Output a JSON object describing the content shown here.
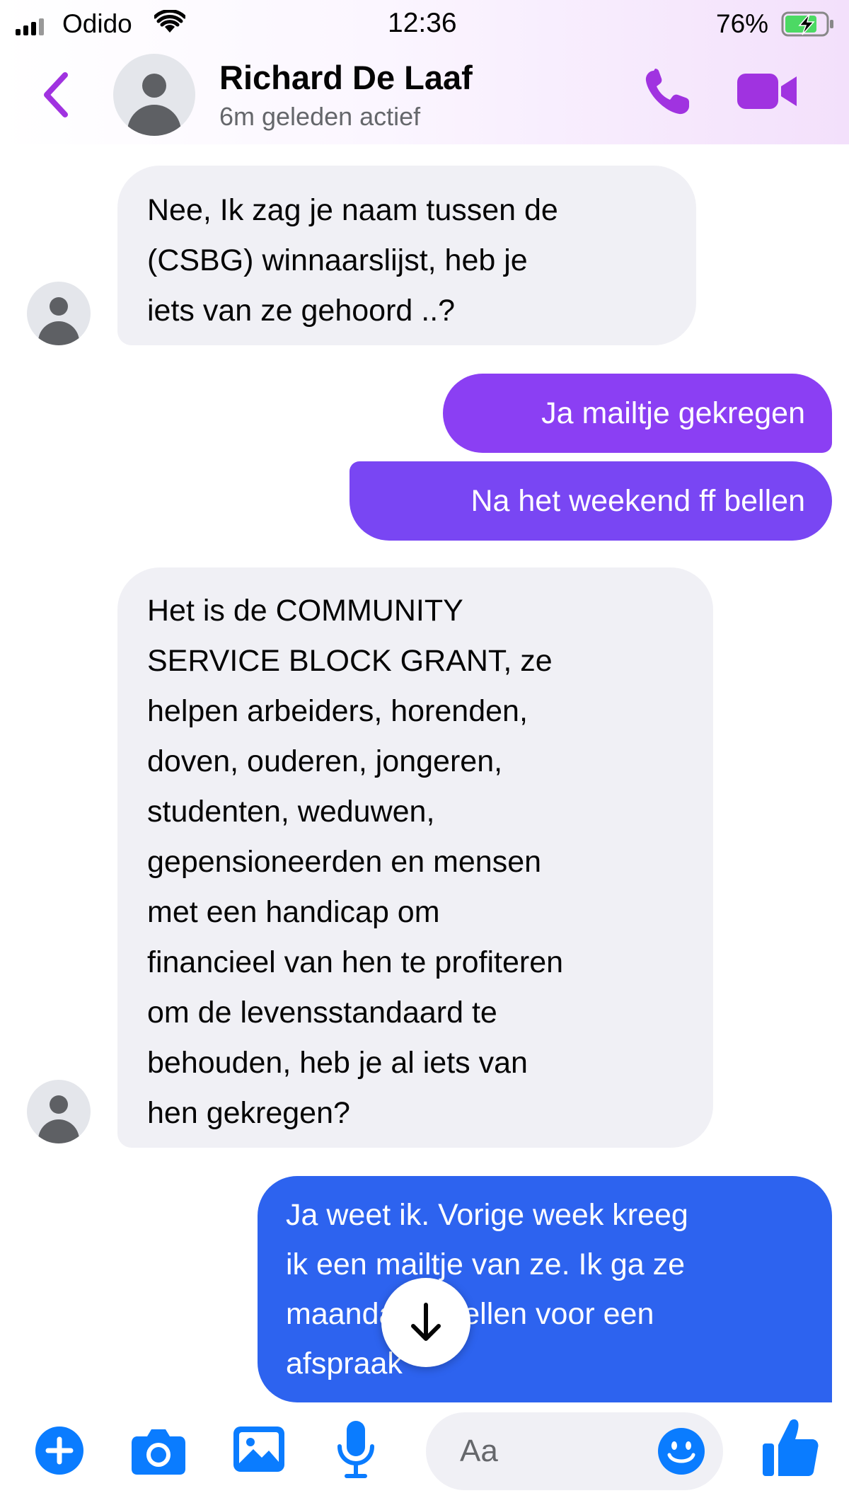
{
  "status_bar": {
    "carrier": "Odido",
    "time": "12:36",
    "battery_percent": "76%"
  },
  "header": {
    "contact_name": "Richard De Laaf",
    "contact_status": "6m geleden actief",
    "accent_color": "#a033e0"
  },
  "messages": [
    {
      "direction": "incoming",
      "lines": [
        "Nee, Ik zag je naam tussen de",
        "(CSBG) winnaarslijst, heb je",
        "iets van ze gehoord ..?"
      ]
    },
    {
      "direction": "outgoing",
      "lines": [
        "Ja mailtje gekregen"
      ],
      "color": "#8b3ff3"
    },
    {
      "direction": "outgoing",
      "lines": [
        "Na het weekend ff bellen"
      ],
      "color": "#7946f3"
    },
    {
      "direction": "incoming",
      "lines": [
        "Het is de COMMUNITY",
        "SERVICE BLOCK GRANT, ze",
        "helpen arbeiders, horenden,",
        "doven, ouderen, jongeren,",
        "studenten, weduwen,",
        "gepensioneerden en mensen",
        "met een handicap om",
        "financieel van hen te profiteren",
        "om de levensstandaard te",
        "behouden, heb je al iets van",
        "hen gekregen?"
      ]
    },
    {
      "direction": "outgoing",
      "lines": [
        "Ja weet ik. Vorige week kreeg",
        "ik een mailtje van ze. Ik ga ze",
        "maandag ff bellen voor een",
        "afspraak"
      ],
      "color": "#2d63ef"
    }
  ],
  "composer": {
    "placeholder": "Aa",
    "icons": [
      "plus-icon",
      "camera-icon",
      "image-icon",
      "microphone-icon",
      "emoji-icon",
      "thumbs-up-icon"
    ],
    "accent_color": "#0a7cff"
  },
  "scroll_button": {
    "icon": "arrow-down-icon"
  }
}
